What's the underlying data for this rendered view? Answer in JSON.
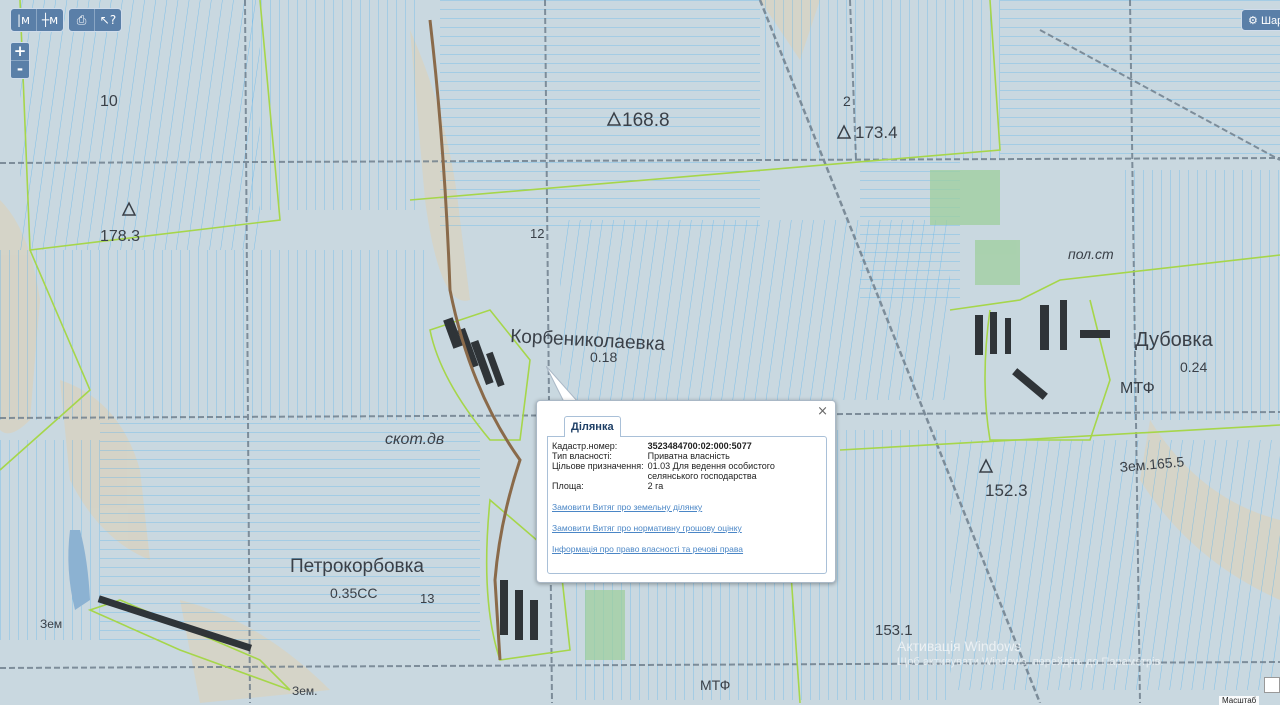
{
  "toolbar": {
    "measure_line_icon": "|м",
    "measure_area_icon": "┼м",
    "print_icon": "⎙",
    "identify_icon": "↖?"
  },
  "zoom": {
    "in_label": "+",
    "out_label": "-"
  },
  "layers_button": {
    "label": "Шар"
  },
  "map_labels": {
    "village_1": "Корбениколаевка",
    "village_1_area": "0.18",
    "village_2": "Дубовка",
    "village_2_area": "0.24",
    "village_2_farm": "МТФ",
    "village_3": "Петрокорбовка",
    "village_3_area": "0.35СС",
    "height_1": "168.8",
    "height_2": "173.4",
    "height_3": "178.3",
    "height_4": "152.3",
    "height_5": "153.1",
    "num_10": "10",
    "num_12": "12",
    "num_2": "2",
    "num_13": "13",
    "skot": "скот.дв",
    "zem_1": "Зем.165.5",
    "zem_2": "Зем.",
    "zem_3": "Зем",
    "mtf_bottom": "МТФ",
    "pol_st": "пол.ст"
  },
  "popup": {
    "tab_label": "Ділянка",
    "close": "×",
    "rows": [
      {
        "key": "Кадастр.номер:",
        "value": "3523484700:02:000:5077"
      },
      {
        "key": "Тип власності:",
        "value": "Приватна власність"
      },
      {
        "key": "Цільове призначення:",
        "value": "01.03 Для ведення особистого селянського господарства"
      },
      {
        "key": "Площа:",
        "value": "2 га"
      }
    ],
    "links": [
      "Замовити Витяг про земельну ділянку",
      "Замовити Витяг про нормативну грошову оцінку",
      "Інформація про право власності та речові права"
    ]
  },
  "watermark": {
    "line1": "Активація Windows",
    "line2": "Щоб активувати Windows, перейдіть до Параметрів."
  },
  "scale": {
    "label": "Масштаб"
  },
  "colors": {
    "map_base": "#c9d8e0",
    "parcel_line": "#5ab4ee",
    "boundary_line": "#a6d64a",
    "road_grid": "#6a7a88",
    "toolbar": "#5a7fa8",
    "link": "#4a86c6"
  }
}
